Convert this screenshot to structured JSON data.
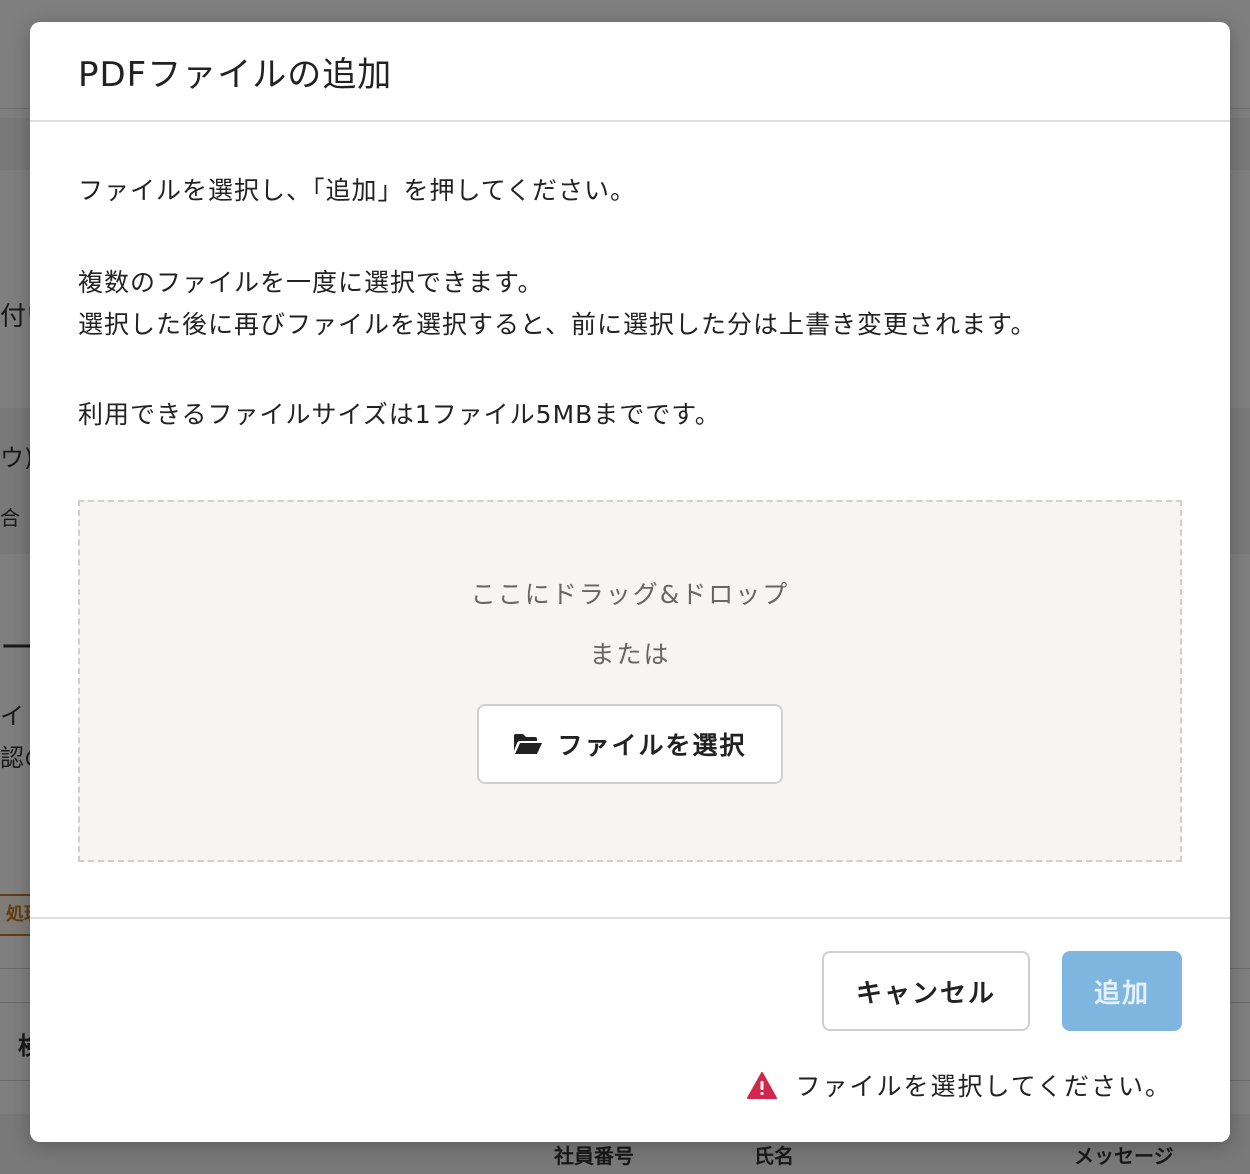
{
  "background": {
    "fragments": [
      "付い",
      "ウ)",
      "合",
      "ート",
      "イ",
      "認の"
    ],
    "badge": "処理",
    "row_fragment": "検",
    "columns": [
      "社員番号",
      "氏名",
      "メッセージ"
    ]
  },
  "modal": {
    "title": "PDFファイルの追加",
    "instructions": [
      "ファイルを選択し、「追加」を押してください。",
      "複数のファイルを一度に選択できます。",
      "選択した後に再びファイルを選択すると、前に選択した分は上書き変更されます。",
      "利用できるファイルサイズは1ファイル5MBまでです。"
    ],
    "dropzone": {
      "drag_text": "ここにドラッグ&ドロップ",
      "or_text": "または",
      "select_label": "ファイルを選択",
      "icon": "folder-open-icon"
    },
    "footer": {
      "cancel_label": "キャンセル",
      "add_label": "追加",
      "add_disabled": true,
      "error_icon": "warning-icon",
      "error_message": "ファイルを選択してください。"
    }
  },
  "colors": {
    "overlay": "#808080",
    "add_button_disabled": "#7fb6e0",
    "error_icon": "#d2264f",
    "badge": "#c77a1e"
  }
}
